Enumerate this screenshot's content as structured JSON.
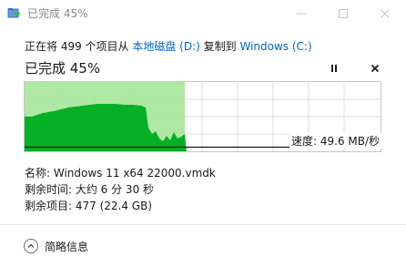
{
  "window": {
    "title": "已完成 45%"
  },
  "copy_line": {
    "prefix": "正在将 499 个项目从 ",
    "source": "本地磁盘 (D:)",
    "middle": " 复制到 ",
    "destination": "Windows (C:)"
  },
  "progress": {
    "label": "已完成 45%",
    "fraction": 0.45
  },
  "speed": {
    "label": "速度: 49.6 MB/秒"
  },
  "details": {
    "name": "名称: Windows 11 x64 22000.vmdk",
    "time_remaining": "剩余时间: 大约 6 分 30 秒",
    "items_remaining": "剩余项目: 477 (22.4 GB)"
  },
  "footer": {
    "less_details": "简略信息"
  },
  "colors": {
    "progress_fill": "#a6e59a",
    "speed_fill": "#06b025",
    "grid": "#dcdcdc",
    "link": "#0067c0"
  }
}
